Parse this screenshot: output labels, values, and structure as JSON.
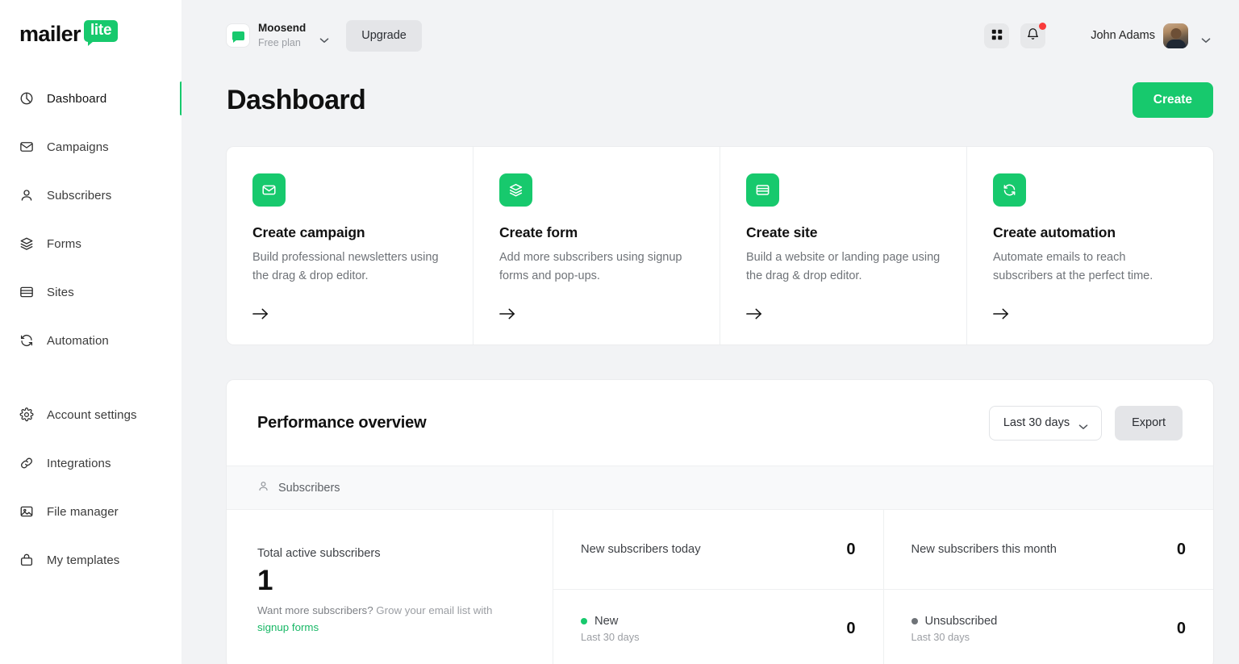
{
  "brand": {
    "logo_primary": "mailer",
    "logo_badge": "lite",
    "green": "#17c96d"
  },
  "sidebar": {
    "groups": [
      {
        "items": [
          {
            "label": "Dashboard",
            "icon": "pie-chart-icon",
            "active": true
          },
          {
            "label": "Campaigns",
            "icon": "envelope-icon",
            "active": false
          },
          {
            "label": "Subscribers",
            "icon": "person-icon",
            "active": false
          },
          {
            "label": "Forms",
            "icon": "layers-icon",
            "active": false
          },
          {
            "label": "Sites",
            "icon": "browser-icon",
            "active": false
          },
          {
            "label": "Automation",
            "icon": "refresh-icon",
            "active": false
          }
        ]
      },
      {
        "items": [
          {
            "label": "Account settings",
            "icon": "gear-icon",
            "active": false
          },
          {
            "label": "Integrations",
            "icon": "link-icon",
            "active": false
          },
          {
            "label": "File manager",
            "icon": "image-icon",
            "active": false
          },
          {
            "label": "My templates",
            "icon": "briefcase-icon",
            "active": false
          }
        ]
      }
    ]
  },
  "topbar": {
    "account_name": "Moosend",
    "account_plan": "Free plan",
    "upgrade_label": "Upgrade",
    "apps_icon": "grid-icon",
    "notifications_icon": "bell-icon",
    "has_notification": true,
    "user_name": "John Adams"
  },
  "page": {
    "title": "Dashboard",
    "create_label": "Create"
  },
  "quick_cards": [
    {
      "icon": "envelope-icon",
      "title": "Create campaign",
      "desc": "Build professional newsletters using the drag & drop editor.",
      "arrow": "arrow-right-icon"
    },
    {
      "icon": "layers-icon",
      "title": "Create form",
      "desc": "Add more subscribers using signup forms and pop-ups.",
      "arrow": "arrow-right-icon"
    },
    {
      "icon": "browser-icon",
      "title": "Create site",
      "desc": "Build a website or landing page using the drag & drop editor.",
      "arrow": "arrow-right-icon"
    },
    {
      "icon": "refresh-icon",
      "title": "Create automation",
      "desc": "Automate emails to reach subscribers at the perfect time.",
      "arrow": "arrow-right-icon"
    }
  ],
  "performance": {
    "title": "Performance overview",
    "range_value": "Last 30 days",
    "export_label": "Export",
    "section_label": "Subscribers",
    "total": {
      "label": "Total active subscribers",
      "value": "1",
      "hint_lead": "Want more subscribers?",
      "hint_rest": " Grow your email list with",
      "hint_link": "signup forms"
    },
    "columns": [
      {
        "rows": [
          {
            "type": "plain",
            "label": "New subscribers today",
            "value": "0"
          },
          {
            "type": "legend",
            "label": "New",
            "sub": "Last 30 days",
            "value": "0",
            "color": "#17c96d"
          }
        ]
      },
      {
        "rows": [
          {
            "type": "plain",
            "label": "New subscribers this month",
            "value": "0"
          },
          {
            "type": "legend",
            "label": "Unsubscribed",
            "sub": "Last 30 days",
            "value": "0",
            "color": "#6f7378"
          }
        ]
      }
    ]
  }
}
